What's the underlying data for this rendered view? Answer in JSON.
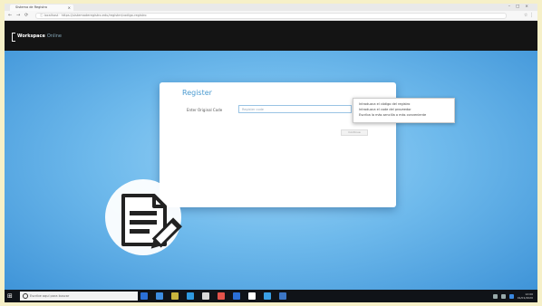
{
  "browser": {
    "tab_title": "Sistema de Registro",
    "tab_close": "×",
    "window_controls": "–□×",
    "nav_back": "←",
    "nav_forward": "→",
    "nav_reload": "⟳",
    "url": "ⓘ localhost · https://sistemaderegistro.edu/register/codigo-registro",
    "addr_icons": "☆ ⋮"
  },
  "header": {
    "brand": "Workspace",
    "brand_sub": "Online"
  },
  "register": {
    "title": "Register",
    "field_label": "Enter Original Code",
    "input_placeholder": "Register code",
    "input_value": "",
    "submit_label": "Continue",
    "tooltip_lines": [
      "Introduzca el código del registro",
      "Introduzca el code del proveedor",
      "Escriba la más sencilla o más conveniente"
    ]
  },
  "taskbar": {
    "start_icon": "⊞",
    "search_placeholder": "Escribe aquí para buscar",
    "clock_time": "12:00",
    "clock_date": "01/01/2020",
    "app_colors": [
      "#2b6fd6",
      "#3d8de0",
      "#c9b43d",
      "#2f9ae0",
      "#d8d8d8",
      "#e2534b",
      "#2b6fd6",
      "#ffffff",
      "#3aa0e6",
      "#3c76c5"
    ]
  },
  "colors": {
    "accent": "#4a9ad0",
    "header_bg": "#141414",
    "background_blue": "#6fbaec"
  }
}
